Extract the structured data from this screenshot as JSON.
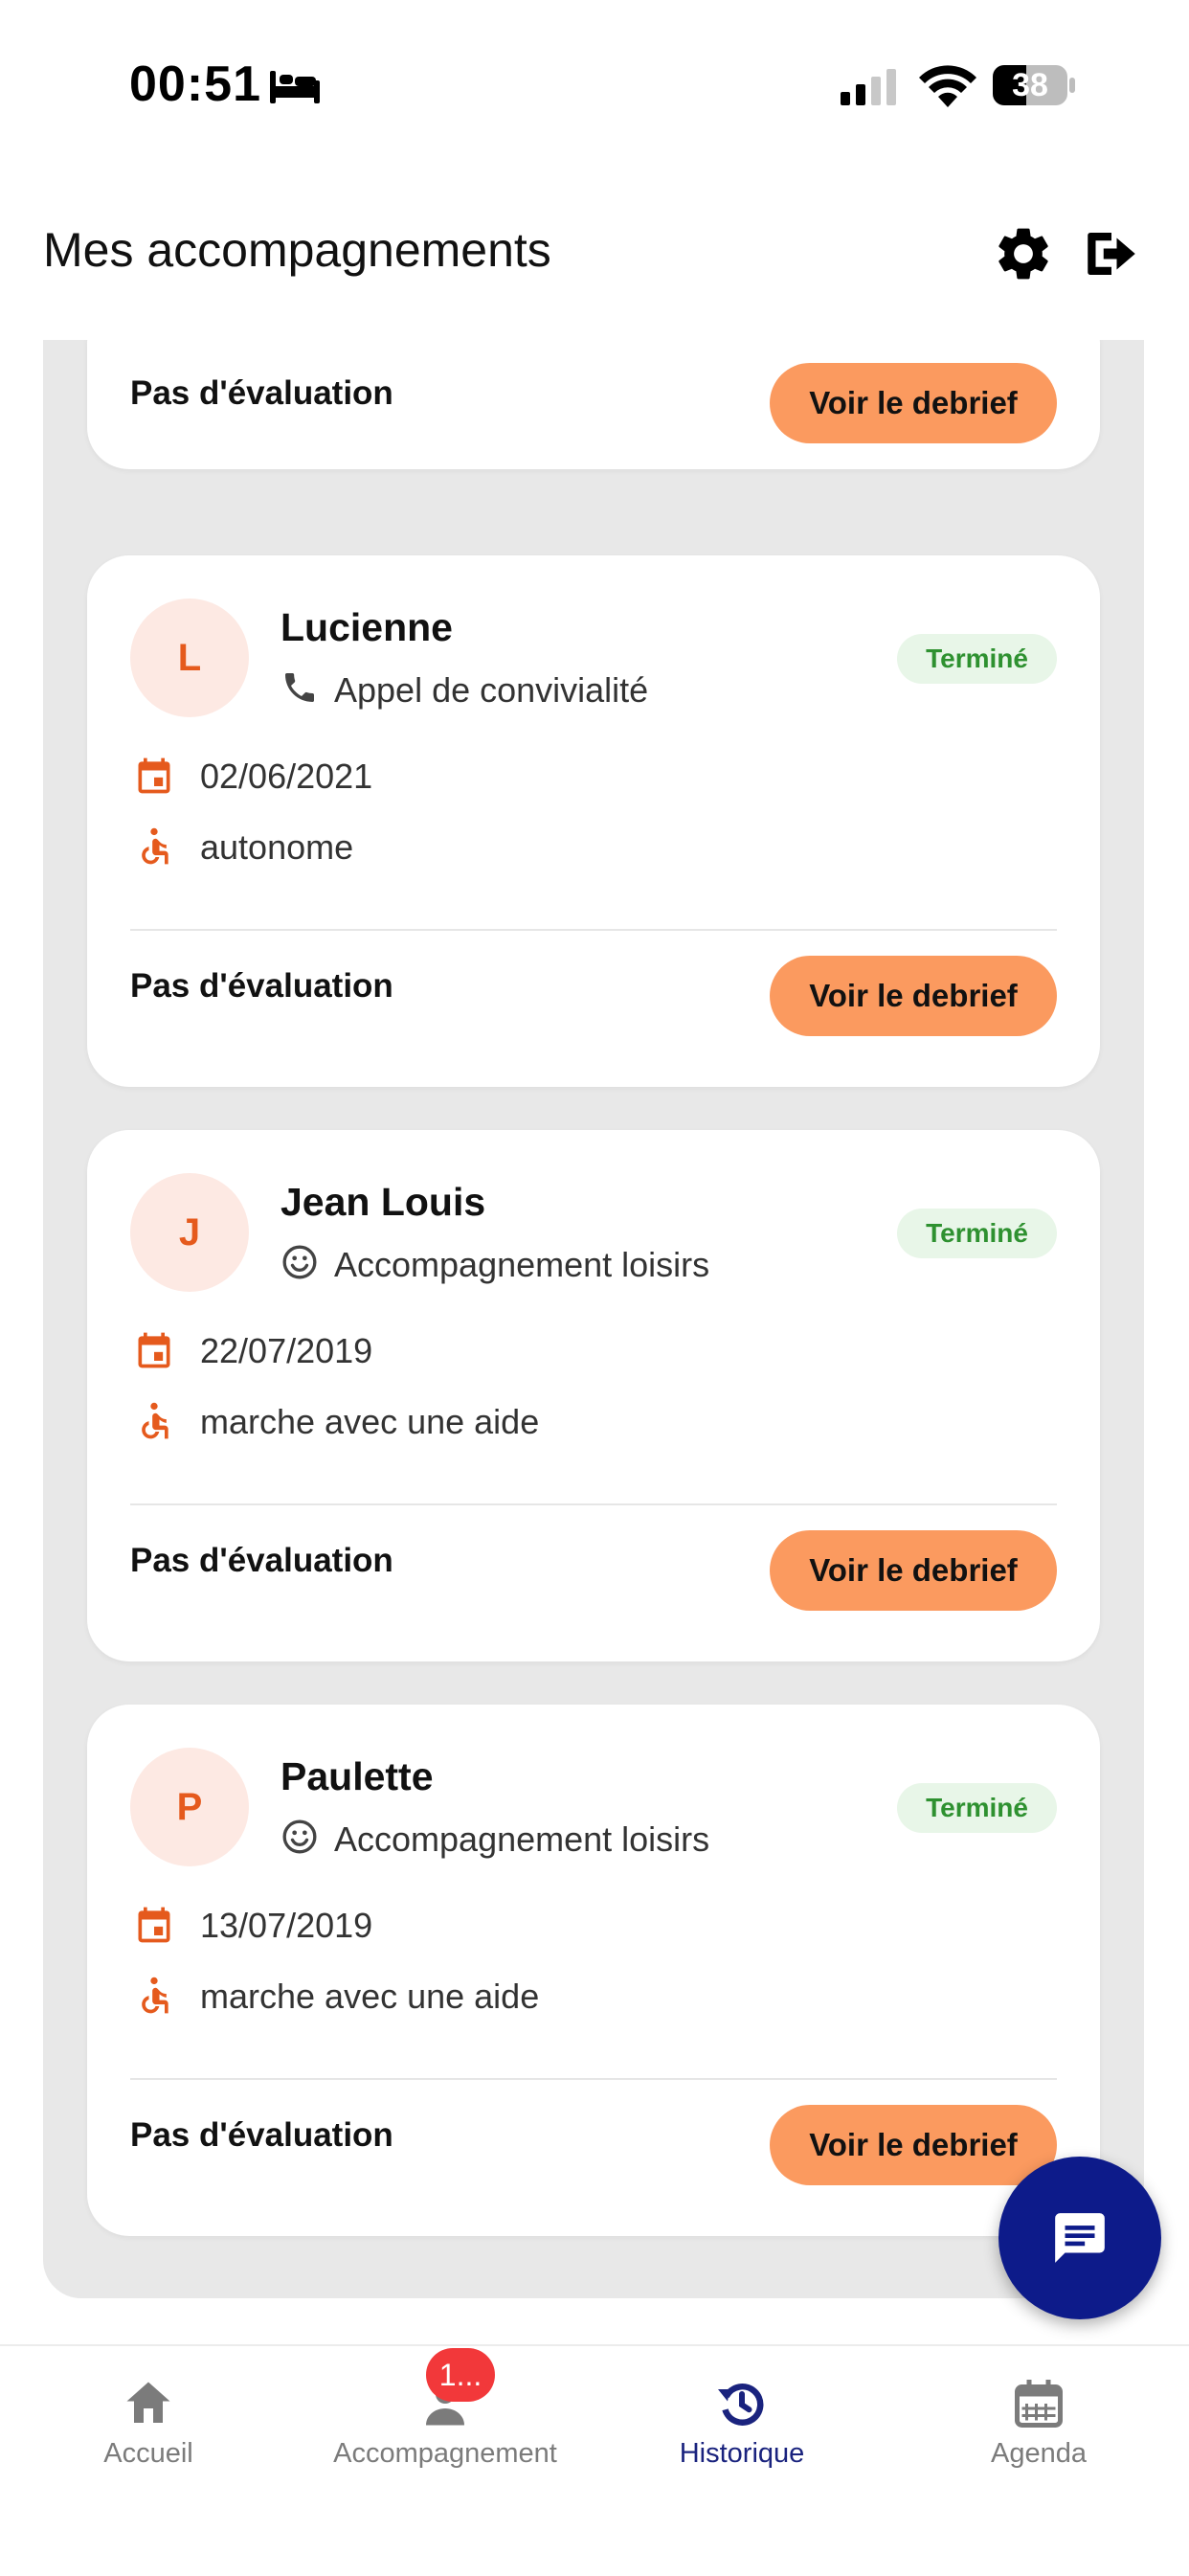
{
  "status_bar": {
    "time": "00:51",
    "battery": "38"
  },
  "header": {
    "title": "Mes accompagnements",
    "settings_icon": "gear-icon",
    "logout_icon": "logout-icon"
  },
  "first_card": {
    "evaluation": "Pas d'évaluation",
    "button": "Voir le debrief"
  },
  "cards": [
    {
      "initial": "L",
      "name": "Lucienne",
      "type": "Appel de convivialité",
      "type_icon": "phone-icon",
      "status": "Terminé",
      "date": "02/06/2021",
      "mobility": "autonome",
      "evaluation": "Pas d'évaluation",
      "button": "Voir le debrief"
    },
    {
      "initial": "J",
      "name": "Jean Louis",
      "type": "Accompagnement loisirs",
      "type_icon": "smiley-icon",
      "status": "Terminé",
      "date": "22/07/2019",
      "mobility": "marche avec une aide",
      "evaluation": "Pas d'évaluation",
      "button": "Voir le debrief"
    },
    {
      "initial": "P",
      "name": "Paulette",
      "type": "Accompagnement loisirs",
      "type_icon": "smiley-icon",
      "status": "Terminé",
      "date": "13/07/2019",
      "mobility": "marche avec une aide",
      "evaluation": "Pas d'évaluation",
      "button": "Voir le debrief"
    }
  ],
  "nav": {
    "items": [
      {
        "label": "Accueil",
        "icon": "home-icon"
      },
      {
        "label": "Accompagnement",
        "icon": "person-icon",
        "badge": "1..."
      },
      {
        "label": "Historique",
        "icon": "history-icon",
        "active": true
      },
      {
        "label": "Agenda",
        "icon": "calendar-icon"
      }
    ]
  },
  "colors": {
    "accent": "#e55a1d",
    "button": "#fb9a5f",
    "nav_active": "#1a237e",
    "fab": "#0d1b8a",
    "status_green": "#2e9130"
  }
}
